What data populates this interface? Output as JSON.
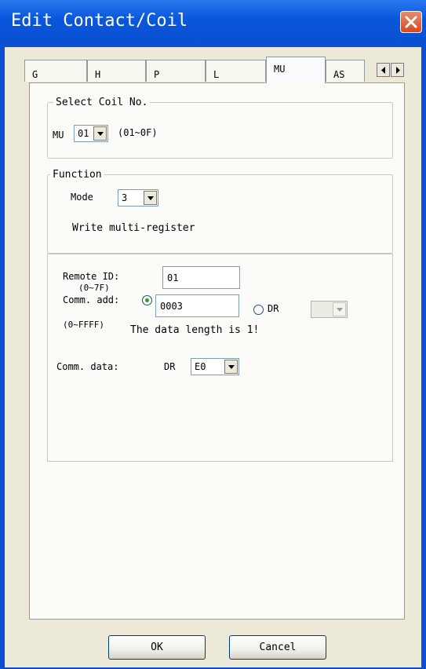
{
  "window": {
    "title": "Edit Contact/Coil"
  },
  "tabs": [
    {
      "label": "G"
    },
    {
      "label": "H"
    },
    {
      "label": "P"
    },
    {
      "label": "L"
    },
    {
      "label": "MU"
    },
    {
      "label": "AS"
    }
  ],
  "active_tab": "MU",
  "select_coil": {
    "legend": "Select Coil No.",
    "prefix": "MU",
    "value": "01",
    "range": "(01~0F)"
  },
  "function": {
    "legend": "Function",
    "mode_label": "Mode",
    "mode_value": "3",
    "description": "Write multi-register"
  },
  "remote": {
    "remote_id_label": "Remote ID:",
    "remote_id_range": "(0~7F)",
    "remote_id_value": "01",
    "comm_add_label": "Comm. add:",
    "comm_add_range": "(0~FFFF)",
    "comm_add_value": "0003",
    "comm_add_selected": true,
    "dr_option_label": "DR",
    "dr_option_selected": false,
    "dr_value": "",
    "length_message": "The data length is 1!",
    "comm_data_label": "Comm. data:",
    "comm_data_prefix": "DR",
    "comm_data_value": "E0"
  },
  "buttons": {
    "ok": "OK",
    "cancel": "Cancel"
  },
  "colors": {
    "titlebar": "#0a4ed1",
    "close_button": "#d8481f",
    "client": "#ece9d8",
    "radio_dot": "#21a121"
  }
}
